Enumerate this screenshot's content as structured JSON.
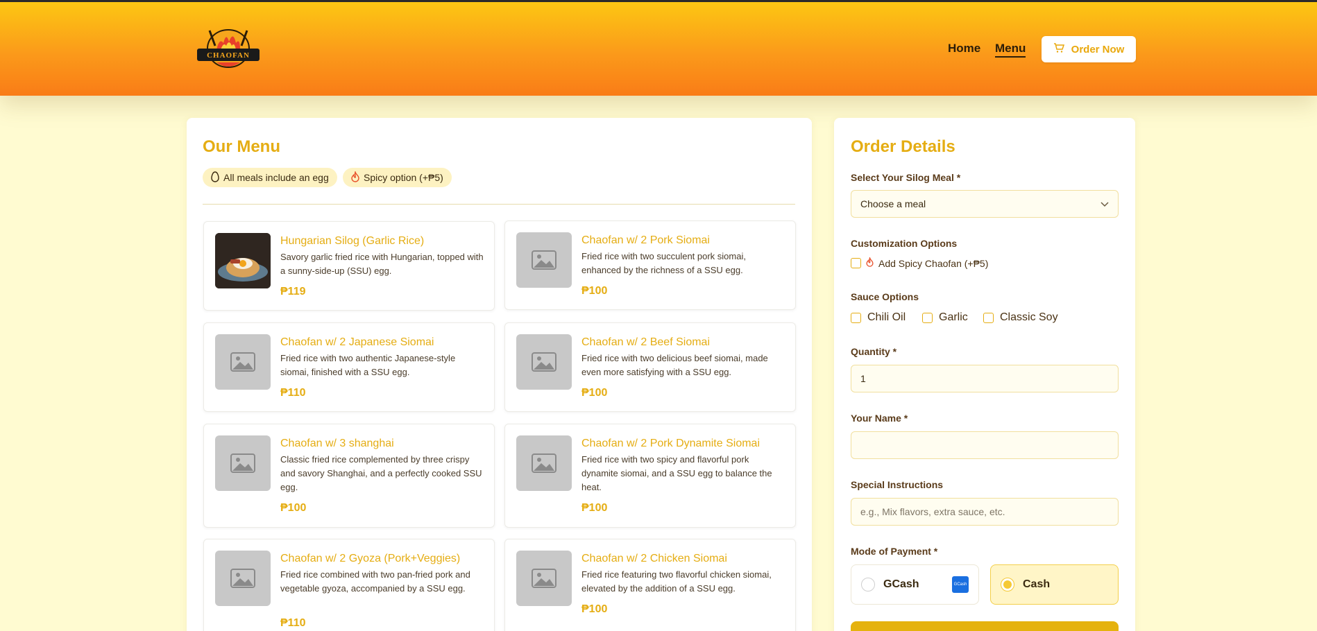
{
  "brand": {
    "logo_text": "CHAOFAN"
  },
  "nav": {
    "home": "Home",
    "menu": "Menu",
    "order_now": "Order Now"
  },
  "menu": {
    "title": "Our Menu",
    "chips": [
      "All meals include an egg",
      "Spicy option (+₱5)"
    ],
    "items": [
      {
        "name": "Hungarian Silog (Garlic Rice)",
        "desc": "Savory garlic fried rice with Hungarian, topped with a sunny-side-up (SSU) egg.",
        "price": "₱119"
      },
      {
        "name": "Chaofan w/ 2 Pork Siomai",
        "desc": "Fried rice with two succulent pork siomai, enhanced by the richness of a SSU egg.",
        "price": "₱100",
        "img_text": "Image Not Available"
      },
      {
        "name": "Chaofan w/ 2 Japanese Siomai",
        "desc": "Fried rice with two authentic Japanese-style siomai, finished with a SSU egg.",
        "price": "₱110",
        "img_text": "Image Not Available"
      },
      {
        "name": "Chaofan w/ 2 Beef Siomai",
        "desc": "Fried rice with two delicious beef siomai, made even more satisfying with a SSU egg.",
        "price": "₱100",
        "img_text": "Image Not Available"
      },
      {
        "name": "Chaofan w/ 3 shanghai",
        "desc": "Classic fried rice complemented by three crispy and savory Shanghai, and a perfectly cooked SSU egg.",
        "price": "₱100",
        "img_text": "Image Not Available"
      },
      {
        "name": "Chaofan w/ 2 Pork Dynamite Siomai",
        "desc": "Fried rice with two spicy and flavorful pork dynamite siomai, and a SSU egg to balance the heat.",
        "price": "₱100",
        "img_text": "Image Not Available"
      },
      {
        "name": "Chaofan w/ 2 Gyoza (Pork+Veggies)",
        "desc": "Fried rice combined with two pan-fried pork and vegetable gyoza, accompanied by a SSU egg.",
        "price": "₱110",
        "img_text": "Image Not Available"
      },
      {
        "name": "Chaofan w/ 2 Chicken Siomai",
        "desc": "Fried rice featuring two flavorful chicken siomai, elevated by the addition of a SSU egg.",
        "price": "₱100",
        "img_text": "Image Not Available"
      }
    ]
  },
  "order": {
    "title": "Order Details",
    "meal_label": "Select Your Silog Meal *",
    "meal_value": "Choose a meal",
    "custom_label": "Customization Options",
    "spicy_option": "Add Spicy Chaofan (+₱5)",
    "sauce_label": "Sauce Options",
    "sauces": [
      "Chili Oil",
      "Garlic",
      "Classic Soy"
    ],
    "qty_label": "Quantity *",
    "qty_value": "1",
    "name_label": "Your Name *",
    "name_value": "",
    "instr_label": "Special Instructions",
    "instr_placeholder": "e.g., Mix flavors, extra sauce, etc.",
    "payment_label": "Mode of Payment *",
    "payment_options": [
      {
        "label": "GCash",
        "badge": "GCash",
        "selected": false
      },
      {
        "label": "Cash",
        "selected": true
      }
    ]
  },
  "colors": {
    "accent": "#e5ad13",
    "header_top": "#fcc713",
    "header_bottom": "#f97c17",
    "background": "#fffbd1"
  }
}
